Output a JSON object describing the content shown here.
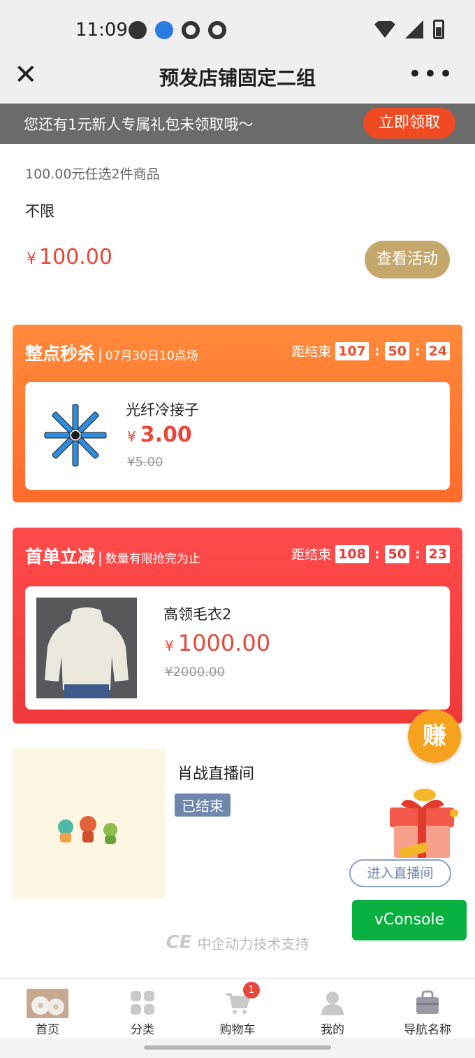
{
  "status_bar": {
    "time": "11:09"
  },
  "title_bar": {
    "title": "预发店铺固定二组",
    "close_glyph": "✕",
    "more_glyph": "•••"
  },
  "promo_banner": {
    "text": "您还有1元新人专属礼包未领取哦～",
    "button": "立即领取"
  },
  "activity": {
    "description": "100.00元任选2件商品",
    "limit": "不限",
    "currency": "¥",
    "price": "100.00",
    "button": "查看活动"
  },
  "seckill": {
    "title": "整点秒杀",
    "separator": "|",
    "subtitle": "07月30日10点场",
    "countdown_label": "距结束",
    "hours": "107",
    "minutes": "50",
    "seconds": "24",
    "product": {
      "name": "光纤冷接子",
      "currency": "¥",
      "price": "3.00",
      "original": "¥5.00"
    }
  },
  "first_order": {
    "title": "首单立减",
    "separator": "|",
    "subtitle": "数量有限抢完为止",
    "countdown_label": "距结束",
    "hours": "108",
    "minutes": "50",
    "seconds": "23",
    "product": {
      "name": "高领毛衣2",
      "currency": "¥",
      "price": "1000.00",
      "original": "¥2000.00"
    }
  },
  "live": {
    "name": "肖战直播间",
    "status": "已结束",
    "enter_button": "进入直播间"
  },
  "floating": {
    "earn": "赚",
    "vconsole": "vConsole"
  },
  "footer": {
    "logo": "CE",
    "support": "中企动力技术支持"
  },
  "tabbar": [
    {
      "label": "首页"
    },
    {
      "label": "分类"
    },
    {
      "label": "购物车",
      "badge": "1"
    },
    {
      "label": "我的"
    },
    {
      "label": "导航名称"
    }
  ],
  "colors": {
    "accent_red": "#e5483a",
    "seckill_orange": "#ff7a30",
    "first_order_red": "#f04444",
    "gold_button": "#c4a76a",
    "vconsole_green": "#08b13f"
  }
}
